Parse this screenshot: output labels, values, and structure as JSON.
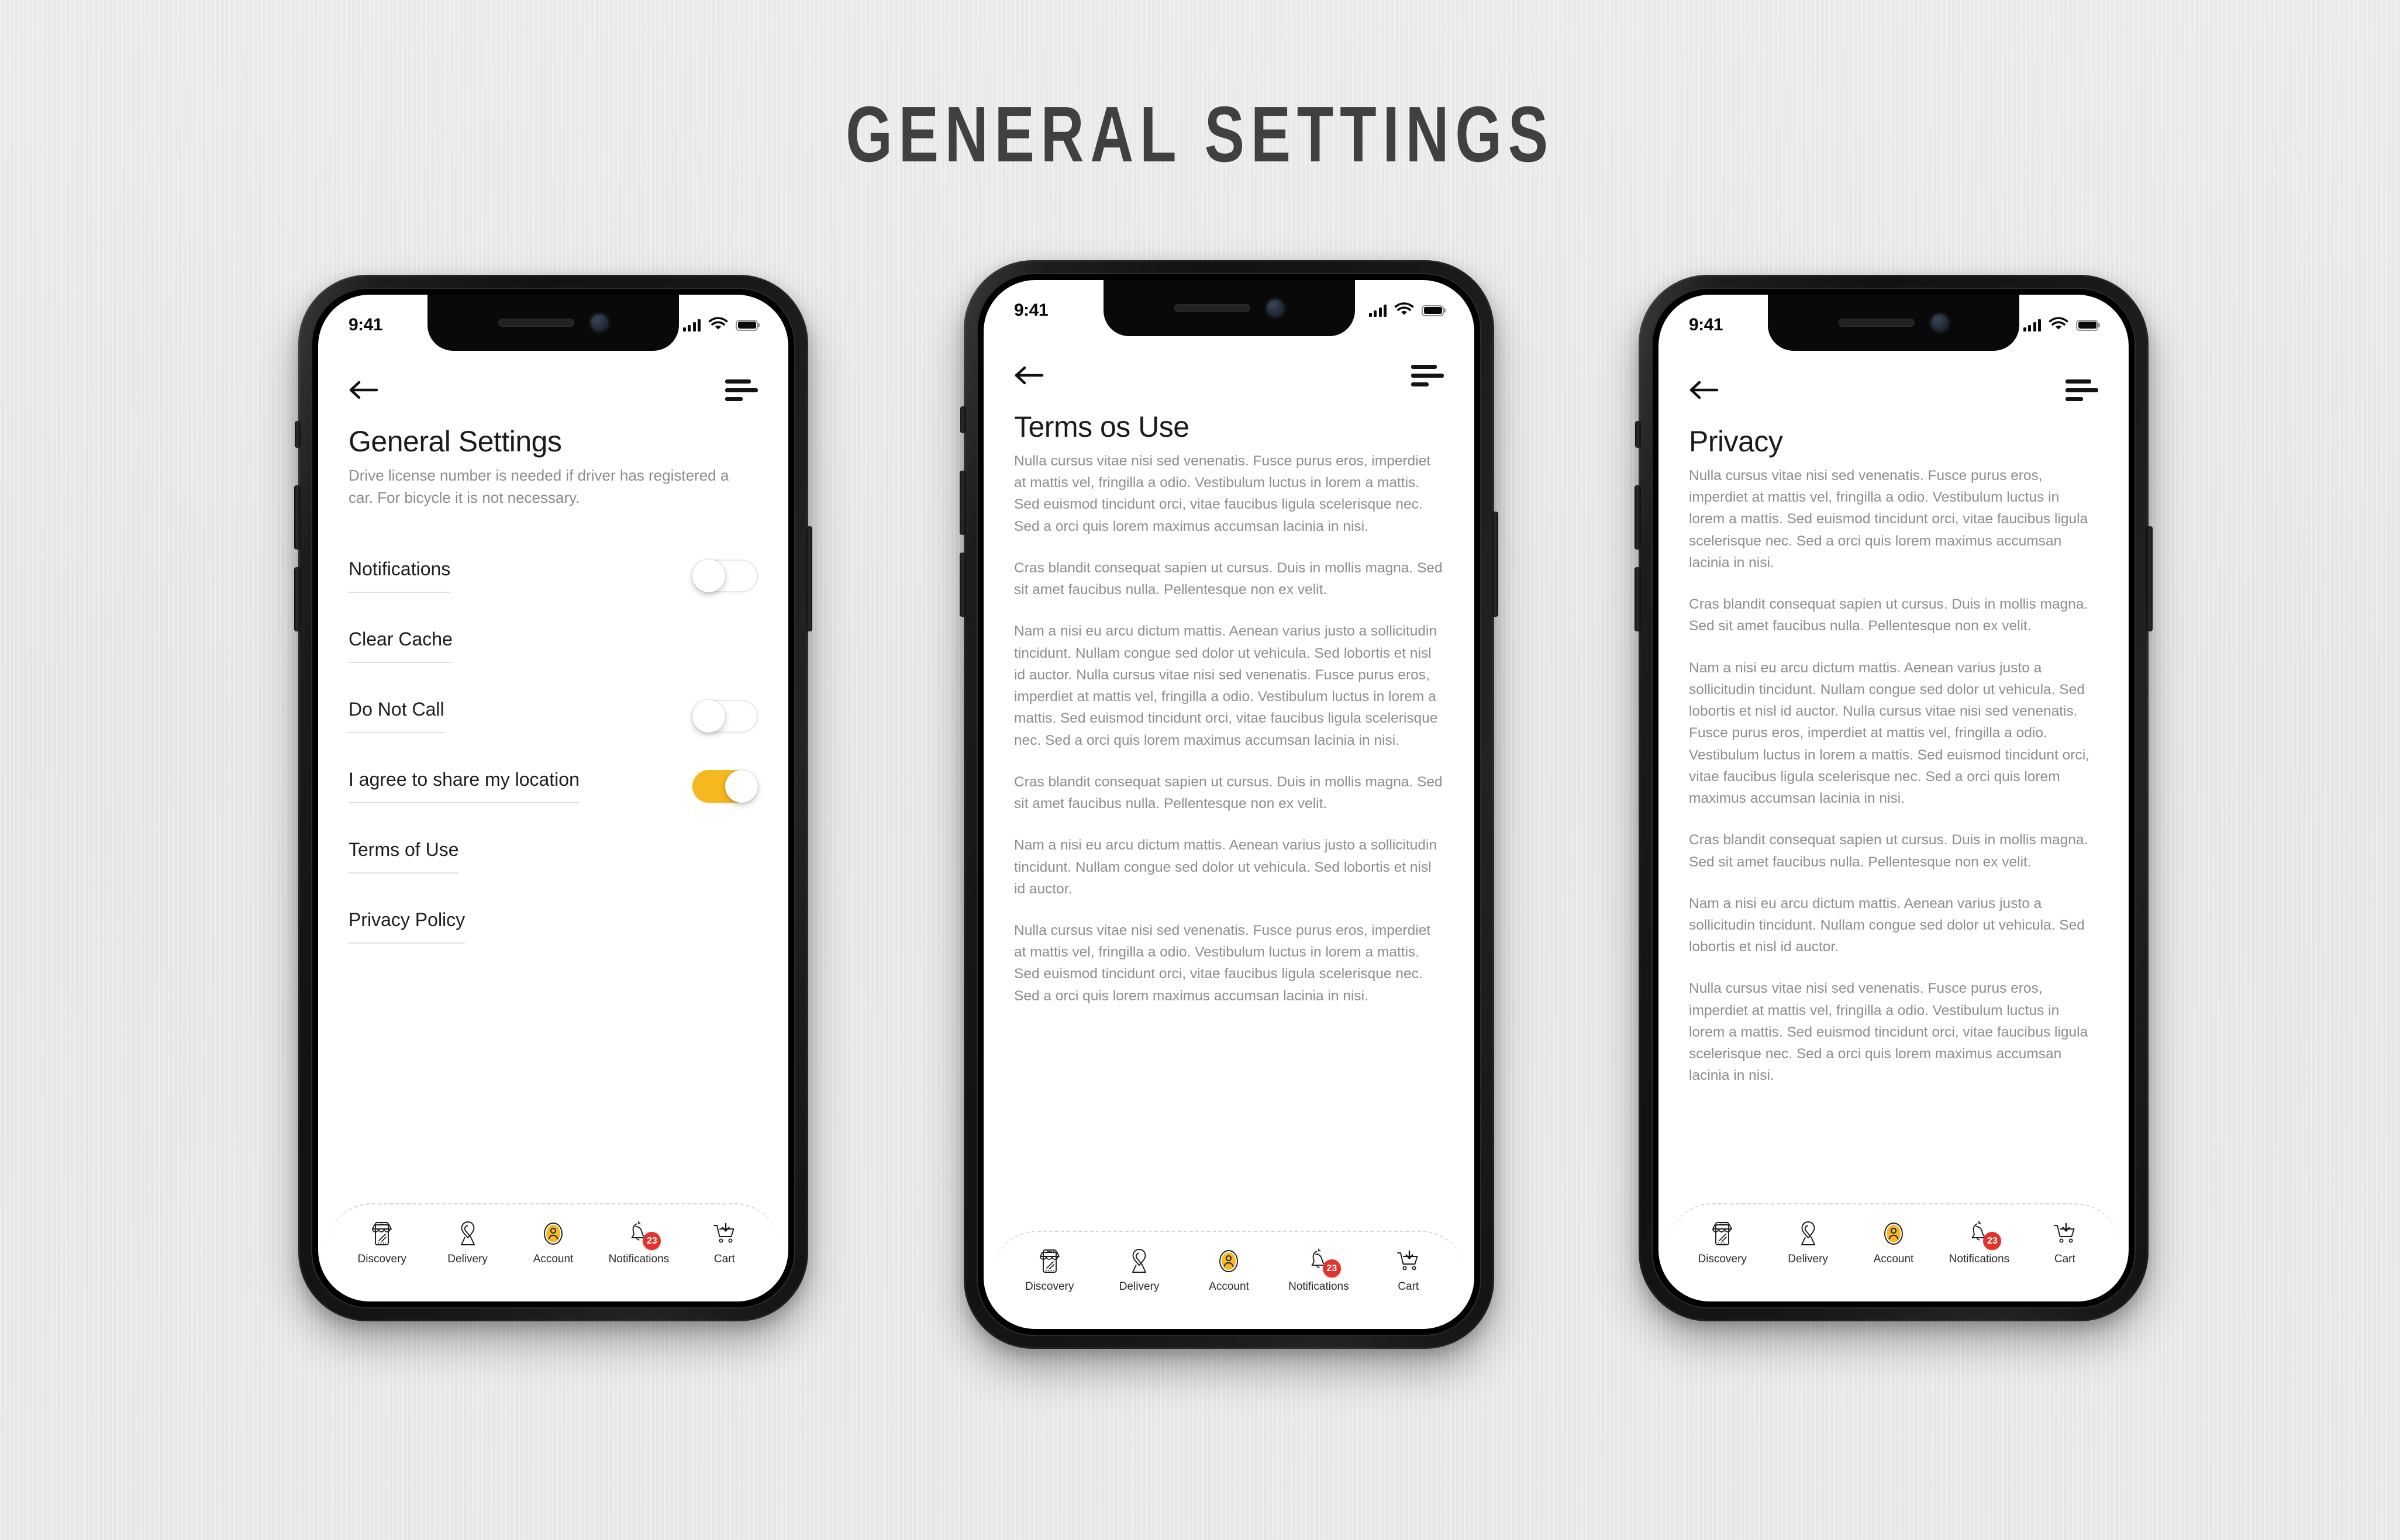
{
  "page": {
    "title": "GENERAL SETTINGS",
    "background_color": "#e4e4e4",
    "title_color": "#3f4042"
  },
  "colors": {
    "accent_yellow": "#f5b81e",
    "badge_red": "#e0342c",
    "body_text": "#8d8d8d",
    "heading_text": "#1b1b1b"
  },
  "status_bar": {
    "time": "9:41",
    "cellular_icon": "signal-bars-icon",
    "wifi_icon": "wifi-icon",
    "battery_icon": "battery-full-icon"
  },
  "app_header": {
    "back_icon": "arrow-left-icon",
    "menu_icon": "menu-lines-icon"
  },
  "bottom_nav": {
    "items": [
      {
        "label": "Discovery",
        "icon": "storefront-icon",
        "active": false
      },
      {
        "label": "Delivery",
        "icon": "location-pin-icon",
        "active": false
      },
      {
        "label": "Account",
        "icon": "user-circle-icon",
        "active": true
      },
      {
        "label": "Notifications",
        "icon": "bell-icon",
        "active": false,
        "badge": "23"
      },
      {
        "label": "Cart",
        "icon": "shopping-cart-icon",
        "active": false
      }
    ]
  },
  "screens": [
    {
      "id": "general-settings",
      "title": "General Settings",
      "subtitle": "Drive license number is needed if driver has registered a car. For bicycle it is not necessary.",
      "settings": [
        {
          "label": "Notifications",
          "control": "toggle",
          "state": "off"
        },
        {
          "label": "Clear Cache",
          "control": "none",
          "state": ""
        },
        {
          "label": "Do Not Call",
          "control": "toggle",
          "state": "off"
        },
        {
          "label": "I agree to share my location",
          "control": "toggle",
          "state": "on"
        },
        {
          "label": "Terms of Use",
          "control": "none",
          "state": ""
        },
        {
          "label": "Privacy Policy",
          "control": "none",
          "state": ""
        }
      ]
    },
    {
      "id": "terms-of-use",
      "title": "Terms os Use",
      "paragraphs": [
        "Nulla cursus vitae nisi sed venenatis. Fusce purus eros, imperdiet at mattis vel, fringilla a odio. Vestibulum luctus in lorem a mattis. Sed euismod tincidunt orci, vitae faucibus ligula scelerisque nec. Sed a orci quis lorem maximus accumsan lacinia in nisi.",
        "Cras blandit consequat sapien ut cursus. Duis in mollis magna. Sed sit amet faucibus nulla. Pellentesque non ex velit.",
        "Nam a nisi eu arcu dictum mattis. Aenean varius justo a sollicitudin tincidunt. Nullam congue sed dolor ut vehicula. Sed lobortis et nisl id auctor. Nulla cursus vitae nisi sed venenatis. Fusce purus eros, imperdiet at mattis vel, fringilla a odio.  Vestibulum luctus in lorem a mattis. Sed euismod tincidunt orci, vitae faucibus ligula scelerisque nec. Sed a orci quis lorem maximus accumsan lacinia in nisi.",
        "Cras blandit consequat sapien ut cursus. Duis in mollis magna. Sed sit amet faucibus nulla. Pellentesque non ex velit.",
        "Nam a nisi eu arcu dictum mattis. Aenean varius justo a sollicitudin tincidunt. Nullam congue sed dolor ut vehicula. Sed lobortis et nisl id auctor.",
        "Nulla cursus vitae nisi sed venenatis. Fusce purus eros, imperdiet at mattis vel, fringilla a odio. Vestibulum luctus in lorem a mattis. Sed euismod tincidunt orci, vitae faucibus ligula scelerisque nec. Sed a orci quis lorem maximus accumsan lacinia in nisi."
      ]
    },
    {
      "id": "privacy",
      "title": "Privacy",
      "paragraphs": [
        "Nulla cursus vitae nisi sed venenatis. Fusce purus eros, imperdiet at mattis vel, fringilla a odio. Vestibulum luctus in lorem a mattis. Sed euismod tincidunt orci, vitae faucibus ligula scelerisque nec. Sed a orci quis lorem maximus accumsan lacinia in nisi.",
        "Cras blandit consequat sapien ut cursus. Duis in mollis magna. Sed sit amet faucibus nulla. Pellentesque non ex velit.",
        "Nam a nisi eu arcu dictum mattis. Aenean varius justo a sollicitudin tincidunt. Nullam congue sed dolor ut vehicula. Sed lobortis et nisl id auctor. Nulla cursus vitae nisi sed venenatis. Fusce purus eros, imperdiet at mattis vel, fringilla a odio.  Vestibulum luctus in lorem a mattis. Sed euismod tincidunt orci, vitae faucibus ligula scelerisque nec. Sed a orci quis lorem maximus accumsan lacinia in nisi.",
        "Cras blandit consequat sapien ut cursus. Duis in mollis magna. Sed sit amet faucibus nulla. Pellentesque non ex velit.",
        "Nam a nisi eu arcu dictum mattis. Aenean varius justo a sollicitudin tincidunt. Nullam congue sed dolor ut vehicula. Sed lobortis et nisl id auctor.",
        "Nulla cursus vitae nisi sed venenatis. Fusce purus eros, imperdiet at mattis vel, fringilla a odio. Vestibulum luctus in lorem a mattis. Sed euismod tincidunt orci, vitae faucibus ligula scelerisque nec. Sed a orci quis lorem maximus accumsan lacinia in nisi."
      ]
    }
  ]
}
